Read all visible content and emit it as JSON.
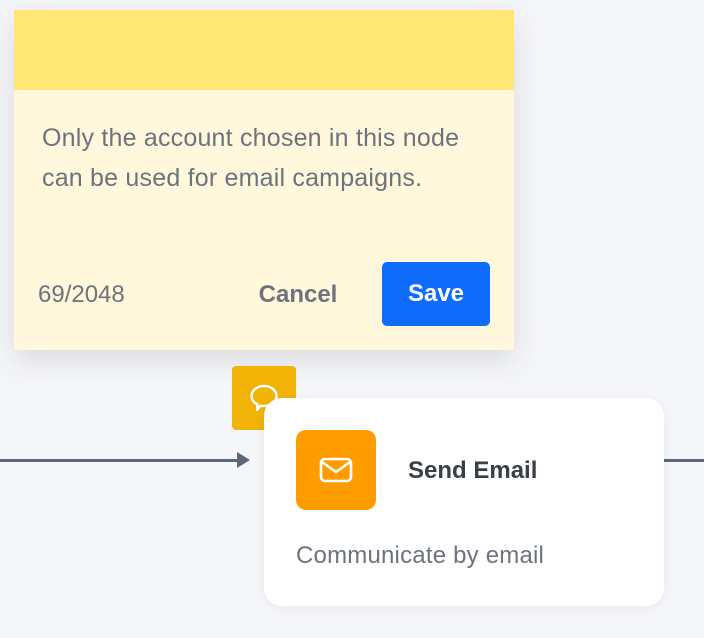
{
  "note": {
    "text": "Only the account chosen in this node can be used for email campaigns.",
    "char_count": "69/2048",
    "cancel_label": "Cancel",
    "save_label": "Save"
  },
  "node": {
    "title": "Send Email",
    "description": "Communicate by email",
    "icon": "envelope-icon",
    "icon_color": "#ff9d00"
  },
  "comment_badge": {
    "icon": "speech-bubble-icon",
    "color": "#f2b307"
  },
  "colors": {
    "note_header": "#ffe675",
    "note_body": "#fff8dd",
    "save_button": "#0f6cfb",
    "connector": "#5d6874",
    "canvas": "#f5f6f9"
  }
}
